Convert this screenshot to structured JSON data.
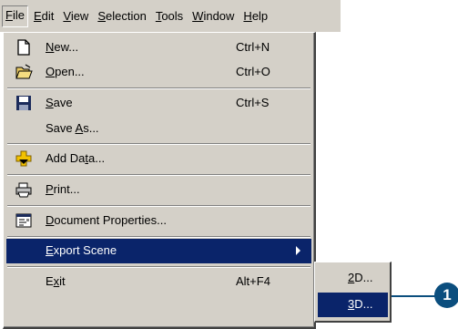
{
  "menubar": {
    "items": [
      {
        "pre": "",
        "acc": "F",
        "post": "ile"
      },
      {
        "pre": "",
        "acc": "E",
        "post": "dit"
      },
      {
        "pre": "",
        "acc": "V",
        "post": "iew"
      },
      {
        "pre": "",
        "acc": "S",
        "post": "election"
      },
      {
        "pre": "",
        "acc": "T",
        "post": "ools"
      },
      {
        "pre": "",
        "acc": "W",
        "post": "indow"
      },
      {
        "pre": "",
        "acc": "H",
        "post": "elp"
      }
    ]
  },
  "file_menu": {
    "new": {
      "pre": "",
      "acc": "N",
      "post": "ew...",
      "shortcut": "Ctrl+N",
      "icon": "new-document-icon"
    },
    "open": {
      "pre": "",
      "acc": "O",
      "post": "pen...",
      "shortcut": "Ctrl+O",
      "icon": "open-folder-icon"
    },
    "save": {
      "pre": "",
      "acc": "S",
      "post": "ave",
      "shortcut": "Ctrl+S",
      "icon": "floppy-disk-icon"
    },
    "save_as": {
      "pre": "Save ",
      "acc": "A",
      "post": "s..."
    },
    "add_data": {
      "pre": "Add Da",
      "acc": "t",
      "post": "a...",
      "icon": "add-data-icon"
    },
    "print": {
      "pre": "",
      "acc": "P",
      "post": "rint...",
      "icon": "printer-icon"
    },
    "doc_props": {
      "pre": "",
      "acc": "D",
      "post": "ocument Properties...",
      "icon": "document-properties-icon"
    },
    "export_scene": {
      "pre": "",
      "acc": "E",
      "post": "xport Scene"
    },
    "exit": {
      "pre": "E",
      "acc": "x",
      "post": "it",
      "shortcut": "Alt+F4"
    }
  },
  "export_submenu": {
    "items": [
      {
        "pre": "",
        "acc": "2",
        "post": "D..."
      },
      {
        "pre": "",
        "acc": "3",
        "post": "D..."
      }
    ]
  },
  "callout": {
    "number": "1"
  },
  "colors": {
    "menu_bg": "#d4d0c8",
    "highlight": "#0a246a",
    "callout": "#0b4e7e"
  }
}
